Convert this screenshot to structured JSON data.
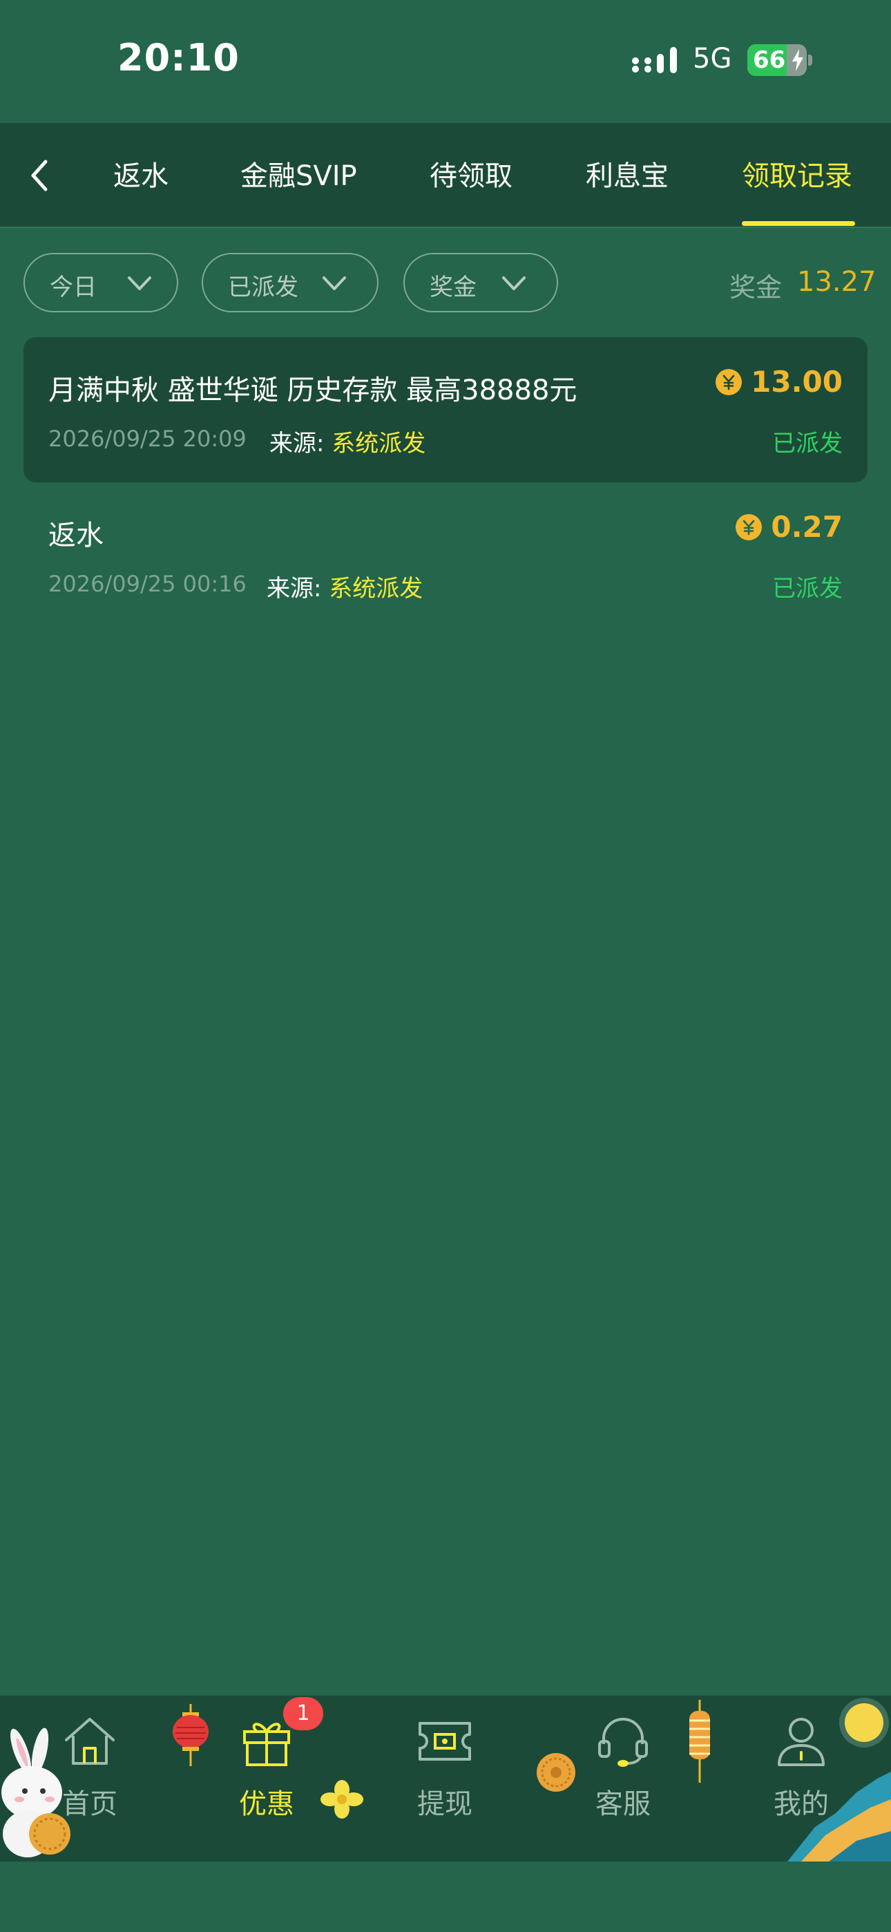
{
  "status_bar": {
    "time": "20:10",
    "network": "5G",
    "battery": 66
  },
  "tabs": [
    {
      "label": "返水",
      "active": false
    },
    {
      "label": "金融SVIP",
      "active": false
    },
    {
      "label": "待领取",
      "active": false
    },
    {
      "label": "利息宝",
      "active": false
    },
    {
      "label": "领取记录",
      "active": true
    }
  ],
  "filters": {
    "date": "今日",
    "status": "已派发",
    "type": "奖金"
  },
  "summary": {
    "label": "奖金",
    "total": "13.27"
  },
  "records": [
    {
      "title": "月满中秋 盛世华诞 历史存款 最高38888元",
      "amount": "13.00",
      "date": "2026/09/25 20:09",
      "source_label": "来源: ",
      "source_value": "系统派发",
      "status": "已派发"
    },
    {
      "title": "返水",
      "amount": "0.27",
      "date": "2026/09/25 00:16",
      "source_label": "来源: ",
      "source_value": "系统派发",
      "status": "已派发"
    }
  ],
  "bottom_nav": [
    {
      "label": "首页",
      "icon": "home-icon",
      "active": false
    },
    {
      "label": "优惠",
      "icon": "gift-icon",
      "active": true,
      "badge": "1"
    },
    {
      "label": "提现",
      "icon": "withdraw-icon",
      "active": false
    },
    {
      "label": "客服",
      "icon": "headset-icon",
      "active": false
    },
    {
      "label": "我的",
      "icon": "user-icon",
      "active": false
    }
  ],
  "colors": {
    "background": "#24654b",
    "panel": "#1c4a38",
    "accent_yellow": "#f3e938",
    "amount_gold": "#f1b62d",
    "status_green": "#2fd061",
    "badge_red": "#f24848"
  }
}
